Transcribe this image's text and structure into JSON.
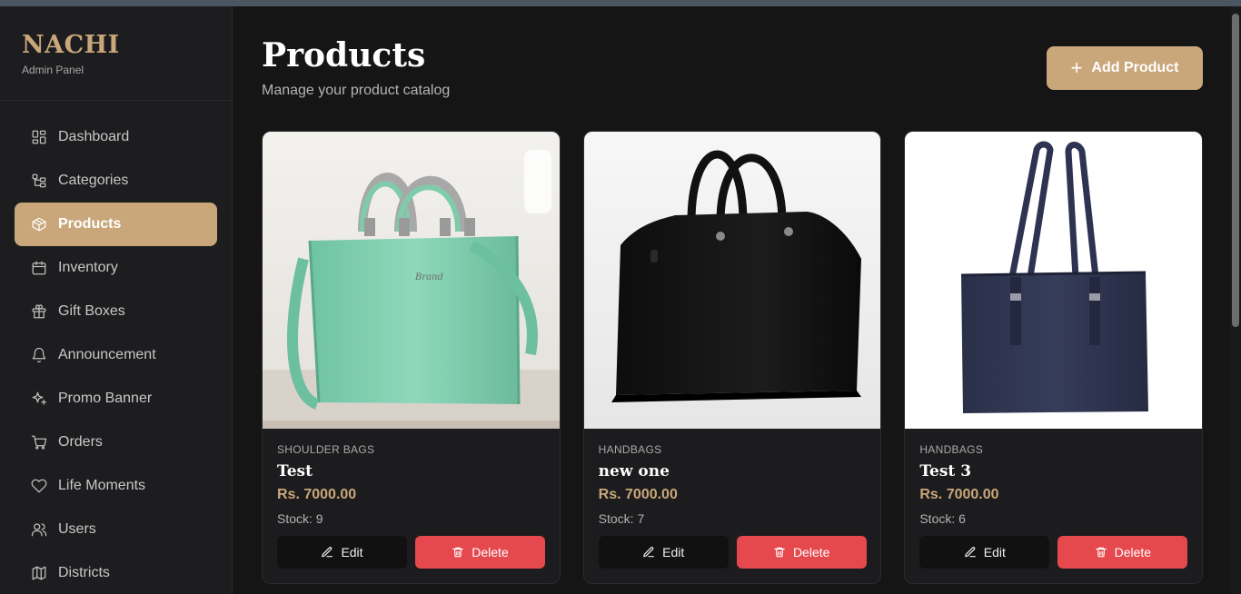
{
  "brand": {
    "title": "NACHI",
    "subtitle": "Admin Panel"
  },
  "sidebar": {
    "items": [
      {
        "label": "Dashboard",
        "icon": "dashboard-icon",
        "active": false
      },
      {
        "label": "Categories",
        "icon": "categories-icon",
        "active": false
      },
      {
        "label": "Products",
        "icon": "box-icon",
        "active": true
      },
      {
        "label": "Inventory",
        "icon": "inventory-icon",
        "active": false
      },
      {
        "label": "Gift Boxes",
        "icon": "gift-icon",
        "active": false
      },
      {
        "label": "Announcement",
        "icon": "bell-icon",
        "active": false
      },
      {
        "label": "Promo Banner",
        "icon": "sparkles-icon",
        "active": false
      },
      {
        "label": "Orders",
        "icon": "cart-icon",
        "active": false
      },
      {
        "label": "Life Moments",
        "icon": "heart-icon",
        "active": false
      },
      {
        "label": "Users",
        "icon": "users-icon",
        "active": false
      },
      {
        "label": "Districts",
        "icon": "map-icon",
        "active": false
      }
    ]
  },
  "header": {
    "title": "Products",
    "subtitle": "Manage your product catalog",
    "add_label": "Add Product"
  },
  "products": [
    {
      "category": "SHOULDER BAGS",
      "name": "Test",
      "price": "Rs. 7000.00",
      "stock": "Stock: 9",
      "image": "mint-green-handbag",
      "edit_label": "Edit",
      "delete_label": "Delete"
    },
    {
      "category": "HANDBAGS",
      "name": "new one",
      "price": "Rs. 7000.00",
      "stock": "Stock: 7",
      "image": "black-handbag",
      "edit_label": "Edit",
      "delete_label": "Delete"
    },
    {
      "category": "HANDBAGS",
      "name": "Test 3",
      "price": "Rs. 7000.00",
      "stock": "Stock: 6",
      "image": "navy-tote-bag",
      "edit_label": "Edit",
      "delete_label": "Delete"
    }
  ],
  "colors": {
    "accent": "#c9a77a",
    "background": "#151515",
    "sidebar": "#1d1d1f",
    "danger": "#e5484d"
  }
}
